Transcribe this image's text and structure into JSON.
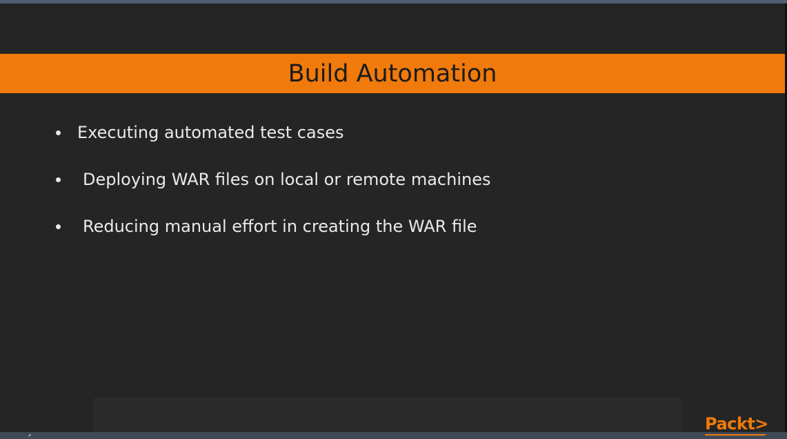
{
  "slide": {
    "title": "Build Automation",
    "bullets": [
      "Executing automated test cases",
      "Deploying WAR files on local or remote machines",
      "Reducing manual effort in creating the WAR file"
    ]
  },
  "brand": {
    "logo_text": "Packt>",
    "accent_color": "#f07a0b",
    "background_color": "#252525"
  }
}
